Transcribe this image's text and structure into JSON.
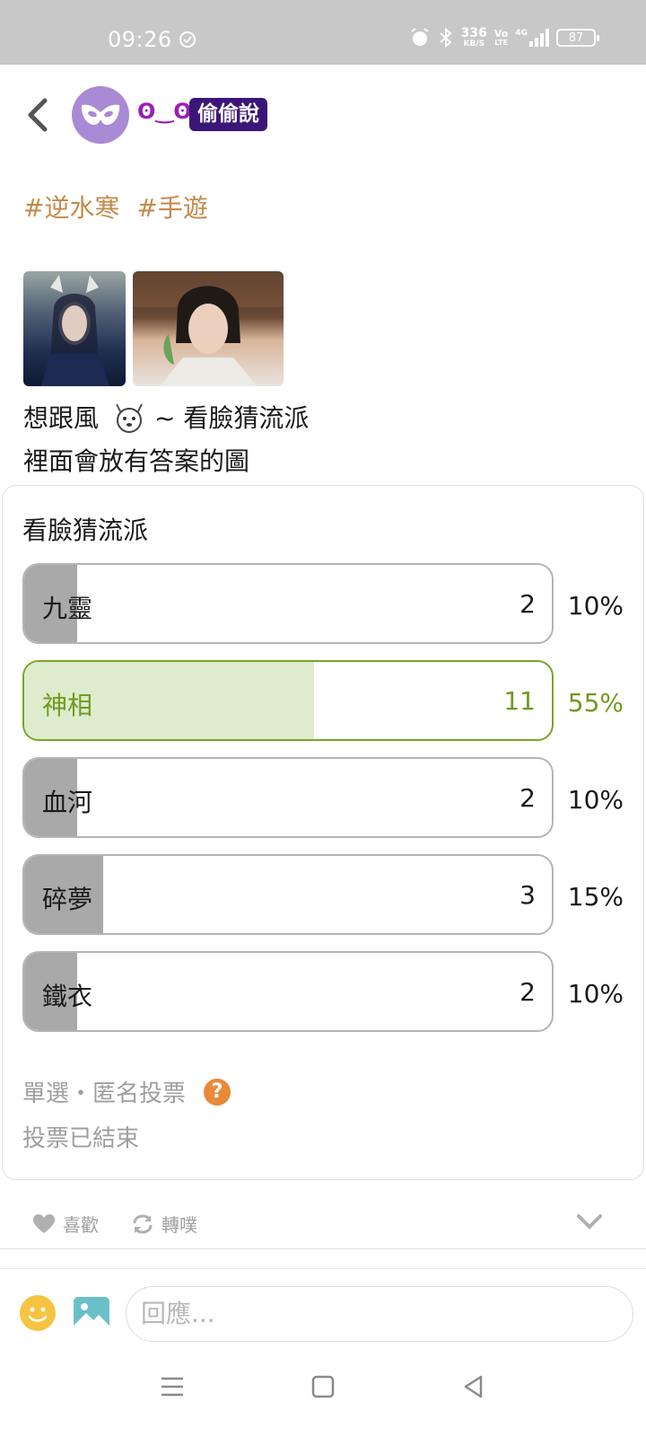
{
  "status_bar": {
    "time": "09:26",
    "net_speed_value": "336",
    "net_speed_unit": "KB/S",
    "volte_top": "Vo",
    "volte_bottom": "LTE",
    "network": "4G",
    "battery": "87"
  },
  "header": {
    "back_icon": "chevron-left-icon",
    "avatar_icon": "mask-icon",
    "nickname": "ʘ‿ʘ",
    "badge": "偷偷說"
  },
  "post": {
    "tags": [
      "#逆水寒",
      "#手遊"
    ],
    "images": [
      "character-image-1",
      "character-image-2"
    ],
    "line1_prefix": "想跟風",
    "line1_suffix": "~ 看臉猜流派",
    "line2": "裡面會放有答案的圖"
  },
  "poll": {
    "title": "看臉猜流派",
    "options": [
      {
        "label": "九靈",
        "count": "2",
        "percent": "10%",
        "fraction": 0.1,
        "winner": false
      },
      {
        "label": "神相",
        "count": "11",
        "percent": "55%",
        "fraction": 0.55,
        "winner": true
      },
      {
        "label": "血河",
        "count": "2",
        "percent": "10%",
        "fraction": 0.1,
        "winner": false
      },
      {
        "label": "碎夢",
        "count": "3",
        "percent": "15%",
        "fraction": 0.15,
        "winner": false
      },
      {
        "label": "鐵衣",
        "count": "2",
        "percent": "10%",
        "fraction": 0.1,
        "winner": false
      }
    ],
    "meta": "單選・匿名投票",
    "help_icon": "?",
    "status": "投票已結束"
  },
  "actions": {
    "like_label": "喜歡",
    "repost_label": "轉噗"
  },
  "reply": {
    "placeholder": "回應..."
  },
  "colors": {
    "accent_green": "#6f9a1f",
    "badge_purple": "#3b1679",
    "tag_orange": "#c48a4b"
  }
}
